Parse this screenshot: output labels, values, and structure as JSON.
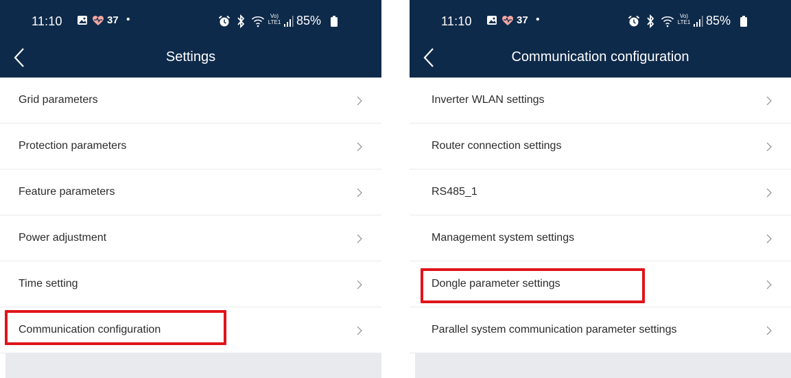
{
  "status_bar": {
    "time": "11:10",
    "temperature": "37",
    "battery_percent": "85%",
    "network_label": "Vo) LTE1"
  },
  "left_screen": {
    "title": "Settings",
    "items": [
      {
        "label": "Grid parameters"
      },
      {
        "label": "Protection parameters"
      },
      {
        "label": "Feature parameters"
      },
      {
        "label": "Power adjustment"
      },
      {
        "label": "Time setting"
      },
      {
        "label": "Communication configuration",
        "highlighted": true
      }
    ]
  },
  "right_screen": {
    "title": "Communication configuration",
    "items": [
      {
        "label": "Inverter WLAN settings"
      },
      {
        "label": "Router connection settings"
      },
      {
        "label": "RS485_1"
      },
      {
        "label": "Management system settings"
      },
      {
        "label": "Dongle parameter settings",
        "highlighted": true
      },
      {
        "label": "Parallel system communication parameter settings"
      }
    ]
  },
  "colors": {
    "header_bg": "#0e2a4a",
    "highlight": "#e0141a",
    "text": "#2b2b2b",
    "divider": "#e8e9ec"
  },
  "icons": {
    "back": "chevron-left-icon",
    "row_arrow": "chevron-right-icon",
    "gallery": "gallery-icon",
    "health": "heart-icon",
    "alarm": "alarm-icon",
    "bluetooth": "bluetooth-icon",
    "wifi": "wifi-icon",
    "signal": "signal-icon",
    "battery": "battery-icon"
  }
}
